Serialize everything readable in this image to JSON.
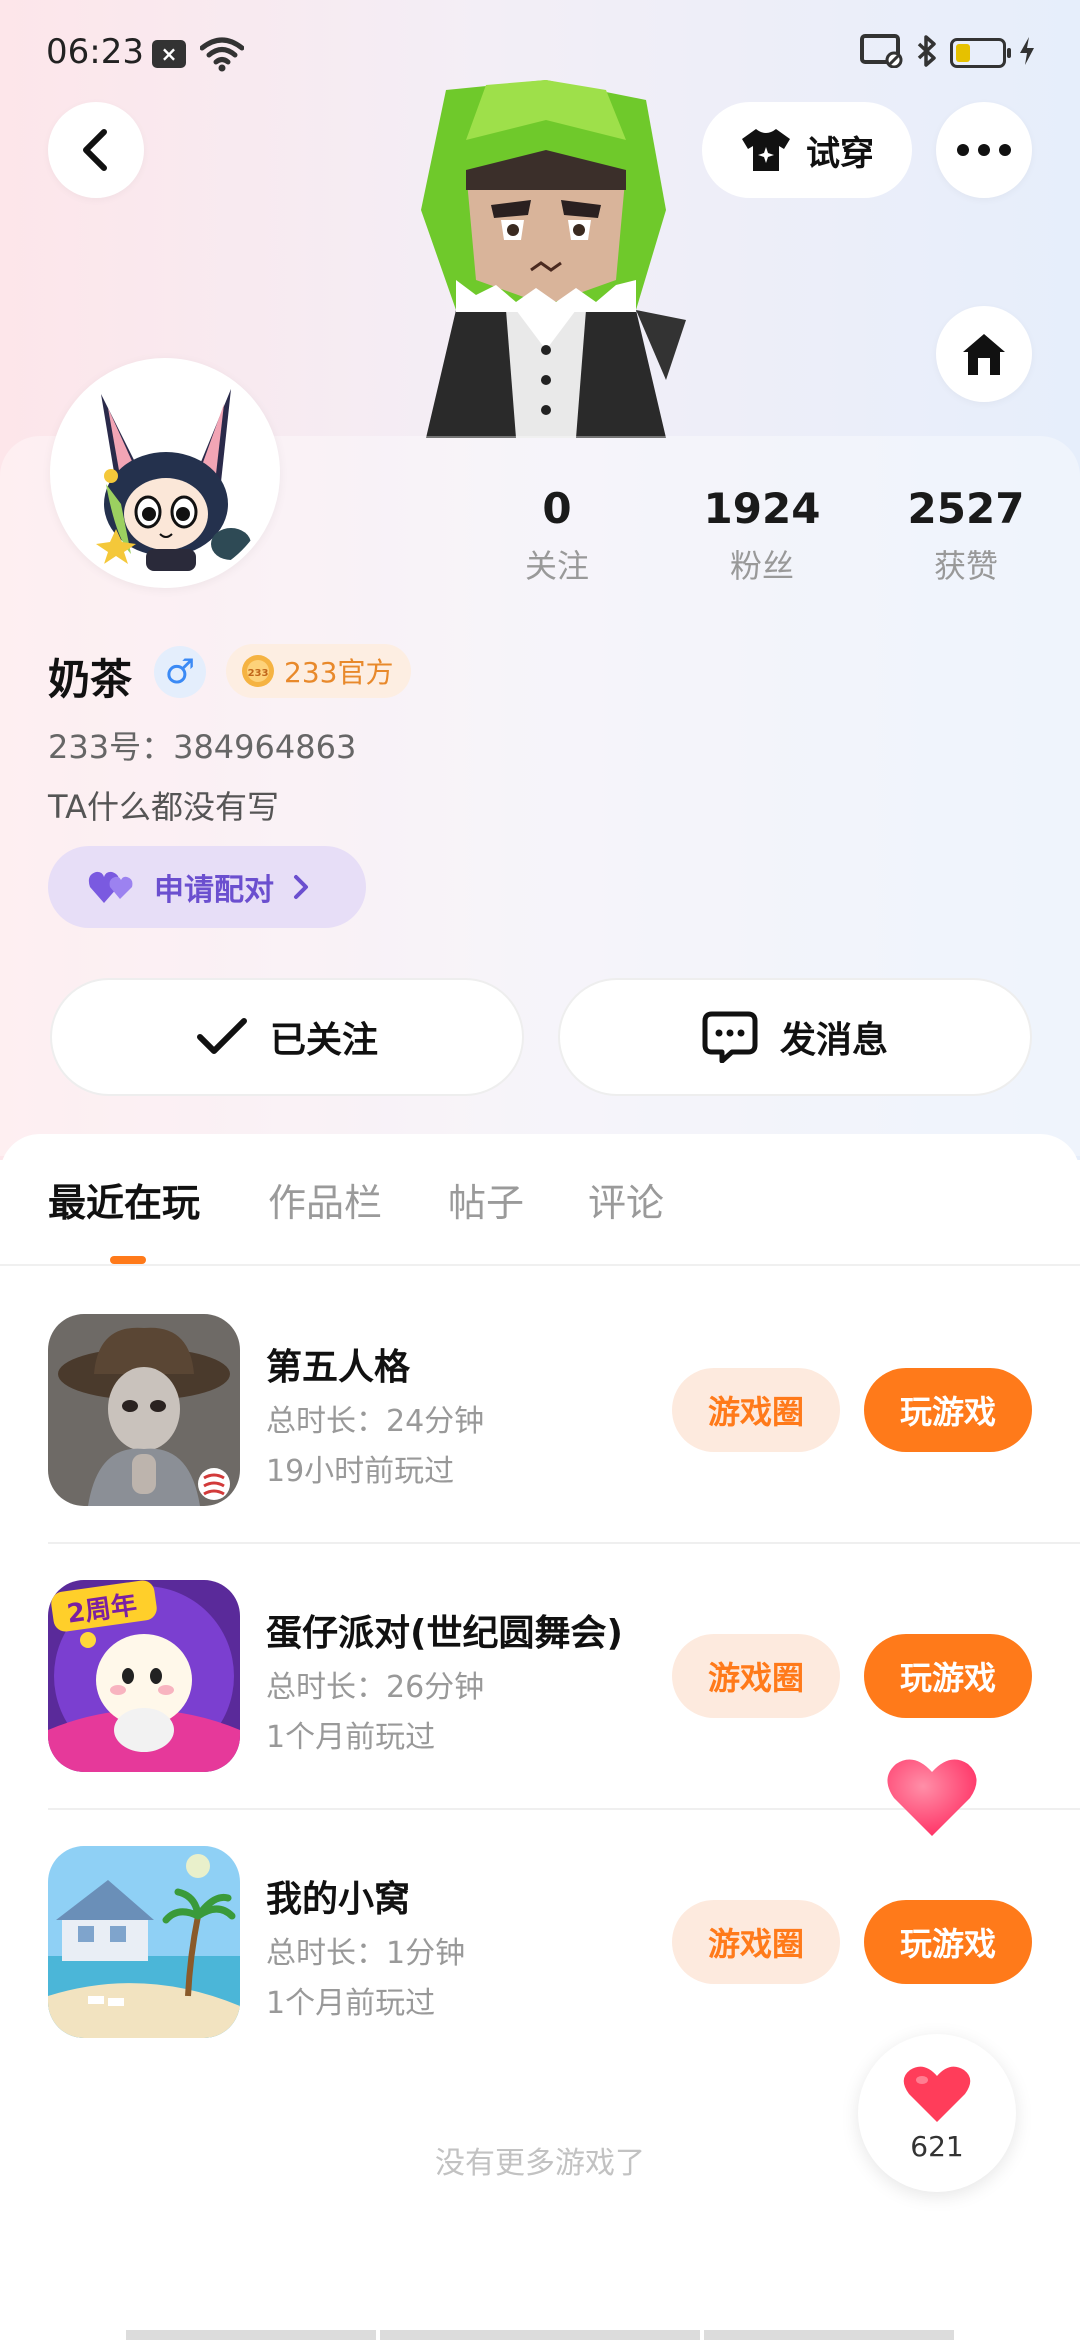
{
  "status_bar": {
    "time": "06:23"
  },
  "header": {
    "try_on_label": "试穿"
  },
  "profile": {
    "username": "奶茶",
    "gender_symbol": "♂",
    "official_badge": "233官方",
    "uid": "233号：384964863",
    "bio": "TA什么都没有写",
    "pair_label": "申请配对",
    "stats": [
      {
        "value": "0",
        "label": "关注"
      },
      {
        "value": "1924",
        "label": "粉丝"
      },
      {
        "value": "2527",
        "label": "获赞"
      }
    ],
    "follow_label": "已关注",
    "message_label": "发消息"
  },
  "tabs": [
    {
      "label": "最近在玩",
      "active": true
    },
    {
      "label": "作品栏",
      "active": false
    },
    {
      "label": "帖子",
      "active": false
    },
    {
      "label": "评论",
      "active": false
    }
  ],
  "games": [
    {
      "name": "第五人格",
      "duration": "总时长：24分钟",
      "last_played": "19小时前玩过",
      "circle_label": "游戏圈",
      "play_label": "玩游戏"
    },
    {
      "name": "蛋仔派对(世纪圆舞会)",
      "duration": "总时长：26分钟",
      "last_played": "1个月前玩过",
      "circle_label": "游戏圈",
      "play_label": "玩游戏",
      "icon_text": "2周年"
    },
    {
      "name": "我的小窝",
      "duration": "总时长：1分钟",
      "last_played": "1个月前玩过",
      "circle_label": "游戏圈",
      "play_label": "玩游戏"
    }
  ],
  "no_more_text": "没有更多游戏了",
  "like_count": "621",
  "colors": {
    "accent": "#ff7a1a",
    "pair": "#6b4fcf",
    "heart": "#ff3d5a"
  }
}
